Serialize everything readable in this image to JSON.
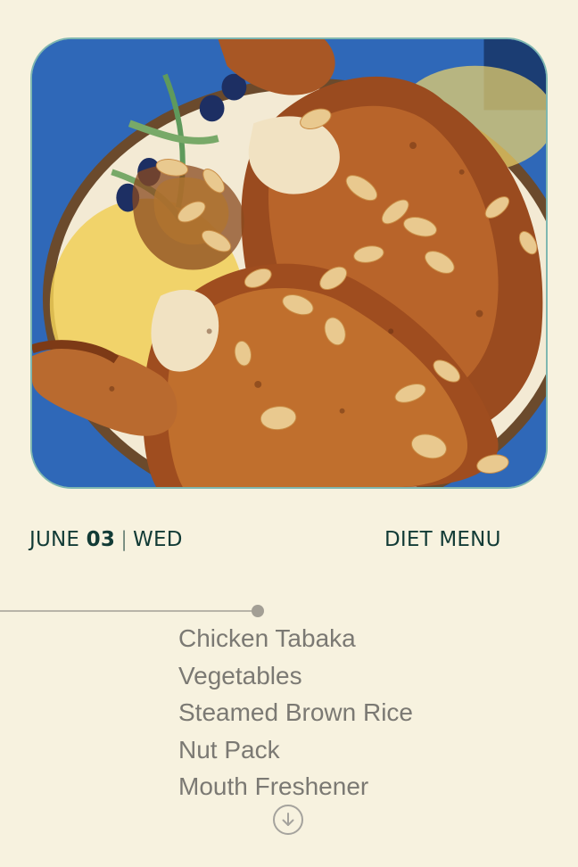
{
  "hero_image": {
    "alt": "Roasted chicken tabaka with sliced almonds on a painted plate"
  },
  "header": {
    "date_month": "JUNE",
    "date_day": "03",
    "date_separator": "|",
    "date_weekday": "WED",
    "menu_title": "DIET MENU"
  },
  "menu": {
    "items": [
      {
        "label": "Chicken Tabaka"
      },
      {
        "label": "Vegetables"
      },
      {
        "label": "Steamed Brown Rice"
      },
      {
        "label": "Nut Pack"
      },
      {
        "label": "Mouth Freshener"
      }
    ]
  },
  "icons": {
    "scroll_down": "arrow-down-circle-icon"
  },
  "colors": {
    "background": "#f7f2df",
    "title_text": "#123b36",
    "menu_text": "#7b7973",
    "image_border": "#7fb7b0",
    "timeline": "#b8b4a8",
    "timeline_dot": "#a39f95",
    "icon": "#a5a39d"
  }
}
